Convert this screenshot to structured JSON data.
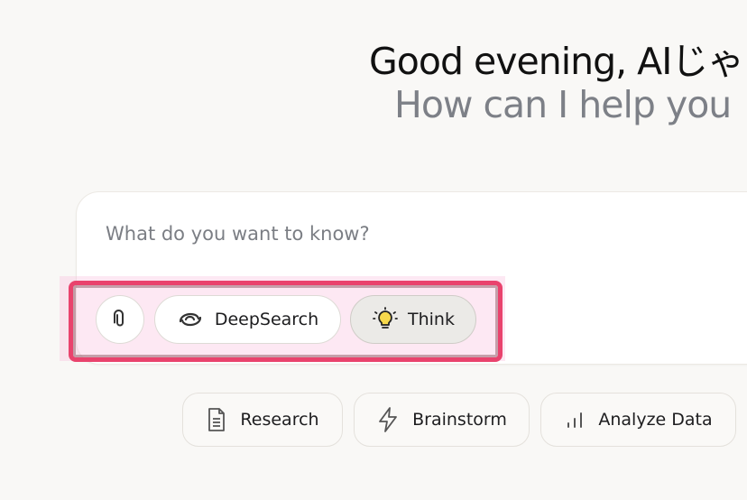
{
  "header": {
    "greeting": "Good evening, AIじゃ",
    "subtitle": "How can I help you"
  },
  "composer": {
    "placeholder": "What do you want to know?",
    "tools": {
      "attach_icon": "paperclip-icon",
      "deepsearch_label": "DeepSearch",
      "deepsearch_icon": "deepsearch-swirl-icon",
      "think_label": "Think",
      "think_icon": "lightbulb-icon",
      "think_active": true
    }
  },
  "suggestions": [
    {
      "label": "Research",
      "icon": "document-icon"
    },
    {
      "label": "Brainstorm",
      "icon": "lightning-icon"
    },
    {
      "label": "Analyze Data",
      "icon": "bar-chart-icon"
    }
  ],
  "annotation": {
    "highlight_color": "#e9436d"
  }
}
